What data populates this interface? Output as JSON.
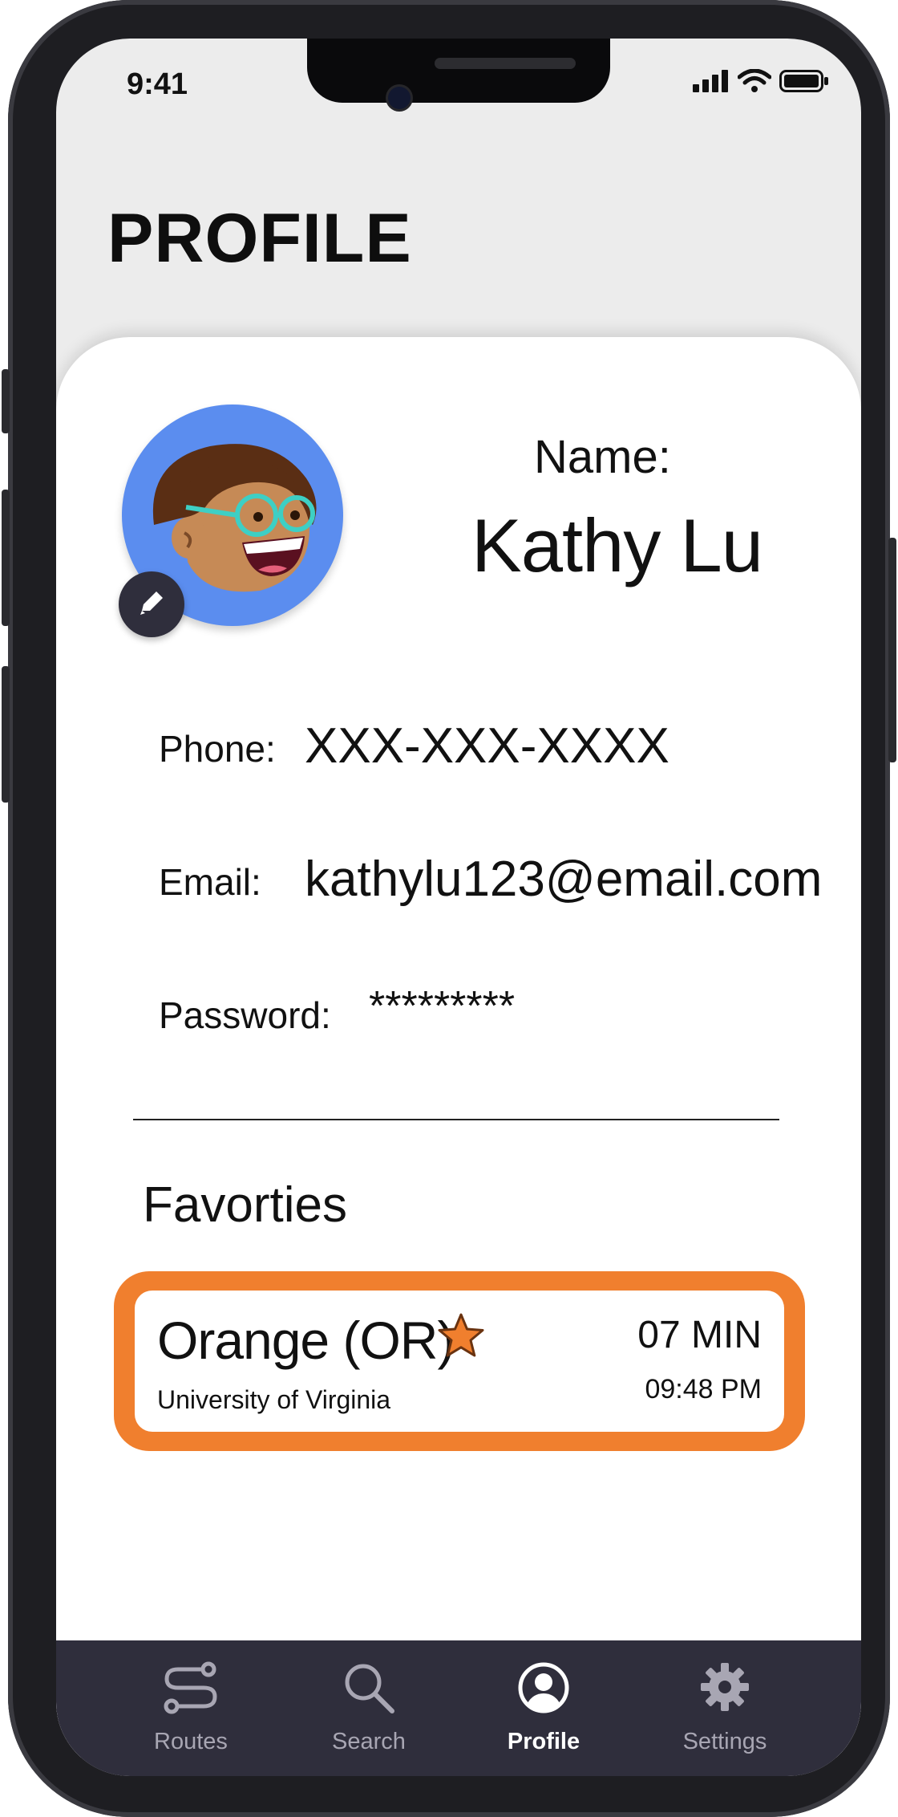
{
  "status": {
    "time": "9:41"
  },
  "header": {
    "title": "PROFILE"
  },
  "profile": {
    "name_label": "Name:",
    "name": "Kathy Lu",
    "phone_label": "Phone:",
    "phone": "XXX-XXX-XXXX",
    "email_label": "Email:",
    "email": "kathylu123@email.com",
    "password_label": "Password:",
    "password": "*********"
  },
  "favorites": {
    "heading": "Favorties",
    "items": [
      {
        "route": "Orange (OR)",
        "stop": "University of Virginia",
        "eta": "07 MIN",
        "time": "09:48 PM",
        "starred": true
      }
    ]
  },
  "tabs": [
    {
      "label": "Routes",
      "icon": "routes-icon"
    },
    {
      "label": "Search",
      "icon": "search-icon"
    },
    {
      "label": "Profile",
      "icon": "profile-icon",
      "active": true
    },
    {
      "label": "Settings",
      "icon": "gear-icon"
    }
  ],
  "colors": {
    "accent": "#f07f2e",
    "tabbar": "#2f2e3c",
    "avatar_bg": "#5b8def"
  }
}
